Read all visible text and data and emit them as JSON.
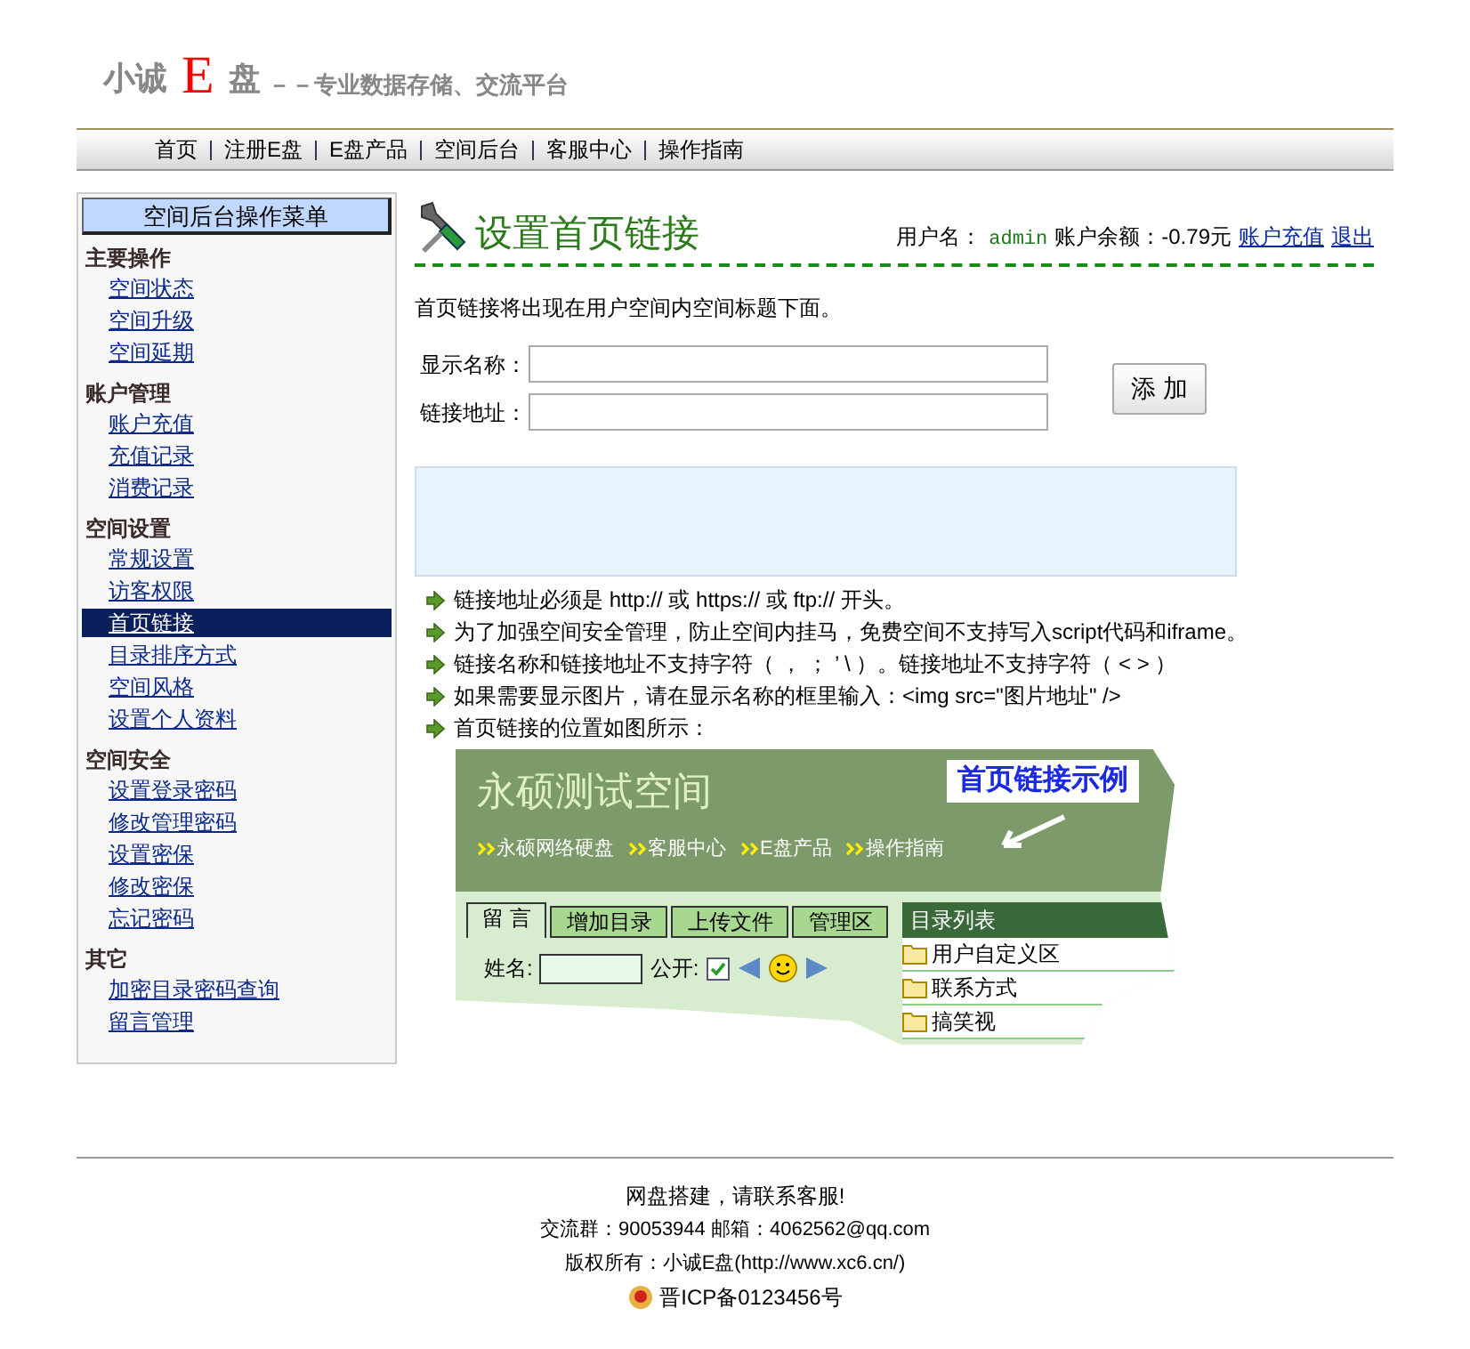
{
  "logo": {
    "part1": "小诚",
    "big": "E",
    "part2": "盘",
    "tagline": "－－专业数据存储、交流平台"
  },
  "nav": [
    "首页",
    "注册E盘",
    "E盘产品",
    "空间后台",
    "客服中心",
    "操作指南"
  ],
  "sidebar": {
    "title": "空间后台操作菜单",
    "groups": [
      {
        "heading": "主要操作",
        "items": [
          {
            "label": "空间状态",
            "selected": false
          },
          {
            "label": "空间升级",
            "selected": false
          },
          {
            "label": "空间延期",
            "selected": false
          }
        ]
      },
      {
        "heading": "账户管理",
        "items": [
          {
            "label": "账户充值",
            "selected": false
          },
          {
            "label": "充值记录",
            "selected": false
          },
          {
            "label": "消费记录",
            "selected": false
          }
        ]
      },
      {
        "heading": "空间设置",
        "items": [
          {
            "label": "常规设置",
            "selected": false
          },
          {
            "label": "访客权限",
            "selected": false
          },
          {
            "label": "首页链接",
            "selected": true
          },
          {
            "label": "目录排序方式",
            "selected": false
          },
          {
            "label": "空间风格",
            "selected": false
          },
          {
            "label": "设置个人资料",
            "selected": false
          }
        ]
      },
      {
        "heading": "空间安全",
        "items": [
          {
            "label": "设置登录密码",
            "selected": false
          },
          {
            "label": "修改管理密码",
            "selected": false
          },
          {
            "label": "设置密保",
            "selected": false
          },
          {
            "label": "修改密保",
            "selected": false
          },
          {
            "label": "忘记密码",
            "selected": false
          }
        ]
      },
      {
        "heading": "其它",
        "items": [
          {
            "label": "加密目录密码查询",
            "selected": false
          },
          {
            "label": "留言管理",
            "selected": false
          }
        ]
      }
    ]
  },
  "page": {
    "title": "设置首页链接",
    "user_label": "用户名：",
    "username": "admin",
    "balance": "账户余额：-0.79元",
    "links": [
      "账户充值",
      "退出"
    ]
  },
  "intro": "首页链接将出现在用户空间内空间标题下面。",
  "form": {
    "fields": [
      {
        "label": "显示名称："
      },
      {
        "label": "链接地址："
      }
    ],
    "button": "添 加"
  },
  "notes": [
    "链接地址必须是 http:// 或 https:// 或 ftp:// 开头。",
    "为了加强空间安全管理，防止空间内挂马，免费空间不支持写入script代码和iframe。",
    "链接名称和链接地址不支持字符（ ， ； ’ \\ ）。链接地址不支持字符（ < > ）",
    "如果需要显示图片，请在显示名称的框里输入：<img src=\"图片地址\" />",
    "首页链接的位置如图所示："
  ],
  "example": {
    "site_title": "永硕测试空间",
    "callout": "首页链接示例",
    "nav_links": [
      "永硕网络硬盘",
      "客服中心",
      "E盘产品",
      "操作指南"
    ],
    "tabs": [
      {
        "label": "留 言",
        "selected": true
      },
      {
        "label": "增加目录",
        "selected": false
      },
      {
        "label": "上传文件",
        "selected": false
      },
      {
        "label": "管理区",
        "selected": false
      }
    ],
    "name_label": "姓名:",
    "public_label": "公开:",
    "public_checked": true,
    "dir_header": "目录列表",
    "dir_items": [
      "用户自定义区",
      "联系方式",
      "搞笑视"
    ]
  },
  "footer": {
    "lines": [
      "网盘搭建，请联系客服!",
      "交流群：90053944 邮箱：4062562@qq.com",
      "版权所有：小诚E盘(http://www.xc6.cn/)"
    ],
    "icp": "晋ICP备0123456号"
  }
}
